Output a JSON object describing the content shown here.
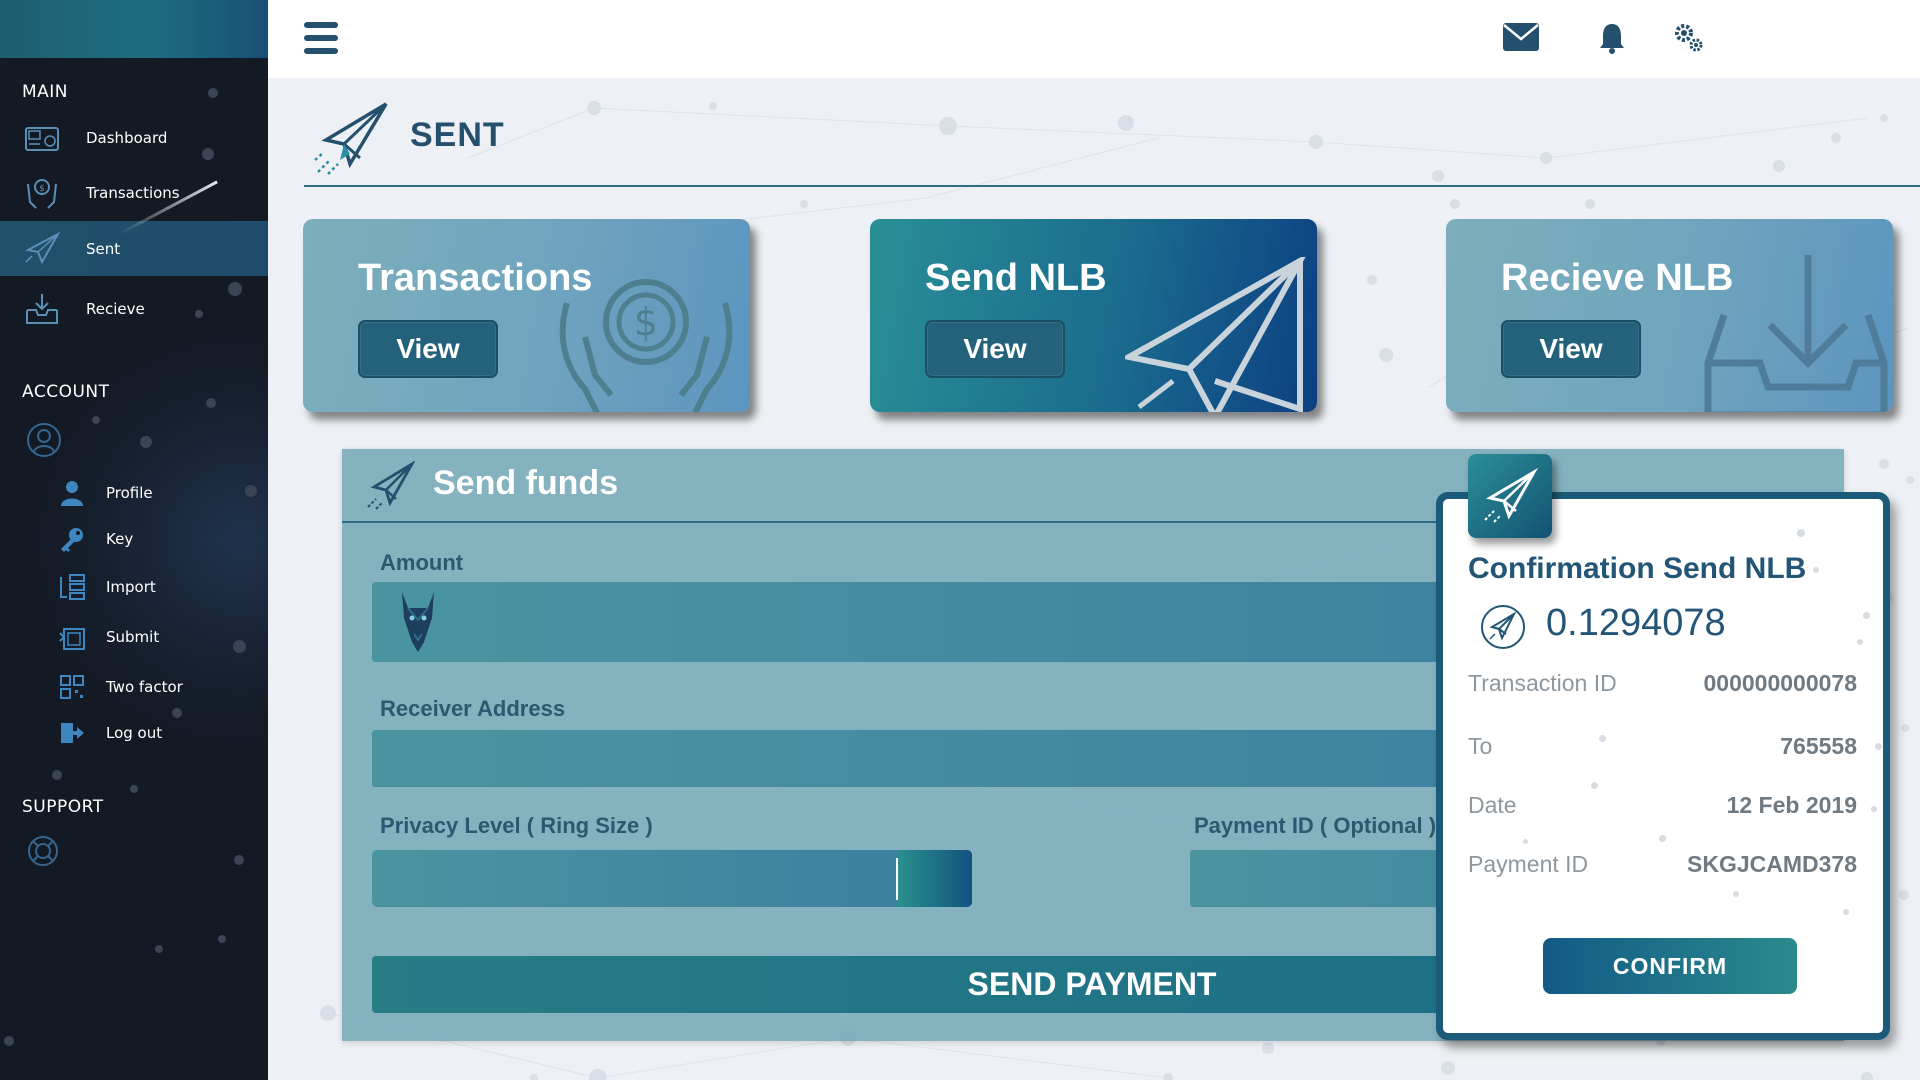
{
  "sidebar": {
    "sections": {
      "main": "MAIN",
      "account": "ACCOUNT",
      "support": "SUPPORT"
    },
    "main_items": [
      {
        "label": "Dashboard",
        "icon": "dashboard-icon"
      },
      {
        "label": "Transactions",
        "icon": "transactions-hands-icon"
      },
      {
        "label": "Sent",
        "icon": "paper-plane-icon",
        "active": true
      },
      {
        "label": "Recieve",
        "icon": "inbox-download-icon"
      }
    ],
    "account_items": [
      {
        "label": "Profile",
        "icon": "user-icon"
      },
      {
        "label": "Key",
        "icon": "key-icon"
      },
      {
        "label": "Import",
        "icon": "import-icon"
      },
      {
        "label": "Submit",
        "icon": "submit-icon"
      },
      {
        "label": "Two factor",
        "icon": "qr-code-icon"
      },
      {
        "label": "Log out",
        "icon": "logout-icon"
      }
    ]
  },
  "topbar": {
    "icons": [
      "menu-icon",
      "mail-icon",
      "bell-icon",
      "settings-gears-icon"
    ]
  },
  "page": {
    "title": "SENT"
  },
  "cards": [
    {
      "title": "Transactions",
      "button": "View"
    },
    {
      "title": "Send NLB",
      "button": "View"
    },
    {
      "title": "Recieve NLB",
      "button": "View"
    }
  ],
  "send_funds": {
    "title": "Send funds",
    "amount_label": "Amount",
    "amount_value": "",
    "receiver_label": "Receiver Address",
    "receiver_value": "",
    "privacy_label": "Privacy Level ( Ring Size )",
    "payment_id_label": "Payment ID ( Optional )",
    "payment_id_value": "",
    "send_button": "SEND PAYMENT"
  },
  "confirmation": {
    "title": "Confirmation Send NLB",
    "amount": "0.1294078",
    "rows": [
      {
        "label": "Transaction ID",
        "value": "000000000078"
      },
      {
        "label": "To",
        "value": "765558"
      },
      {
        "label": "Date",
        "value": "12 Feb 2019"
      },
      {
        "label": "Payment ID",
        "value": "SKGJCAMD378"
      }
    ],
    "confirm_button": "CONFIRM"
  },
  "colors": {
    "sidebar_bg": "#141a24",
    "accent_dark": "#25506d",
    "panel_teal": "#66a0b0",
    "modal_border": "#1c5a79"
  }
}
